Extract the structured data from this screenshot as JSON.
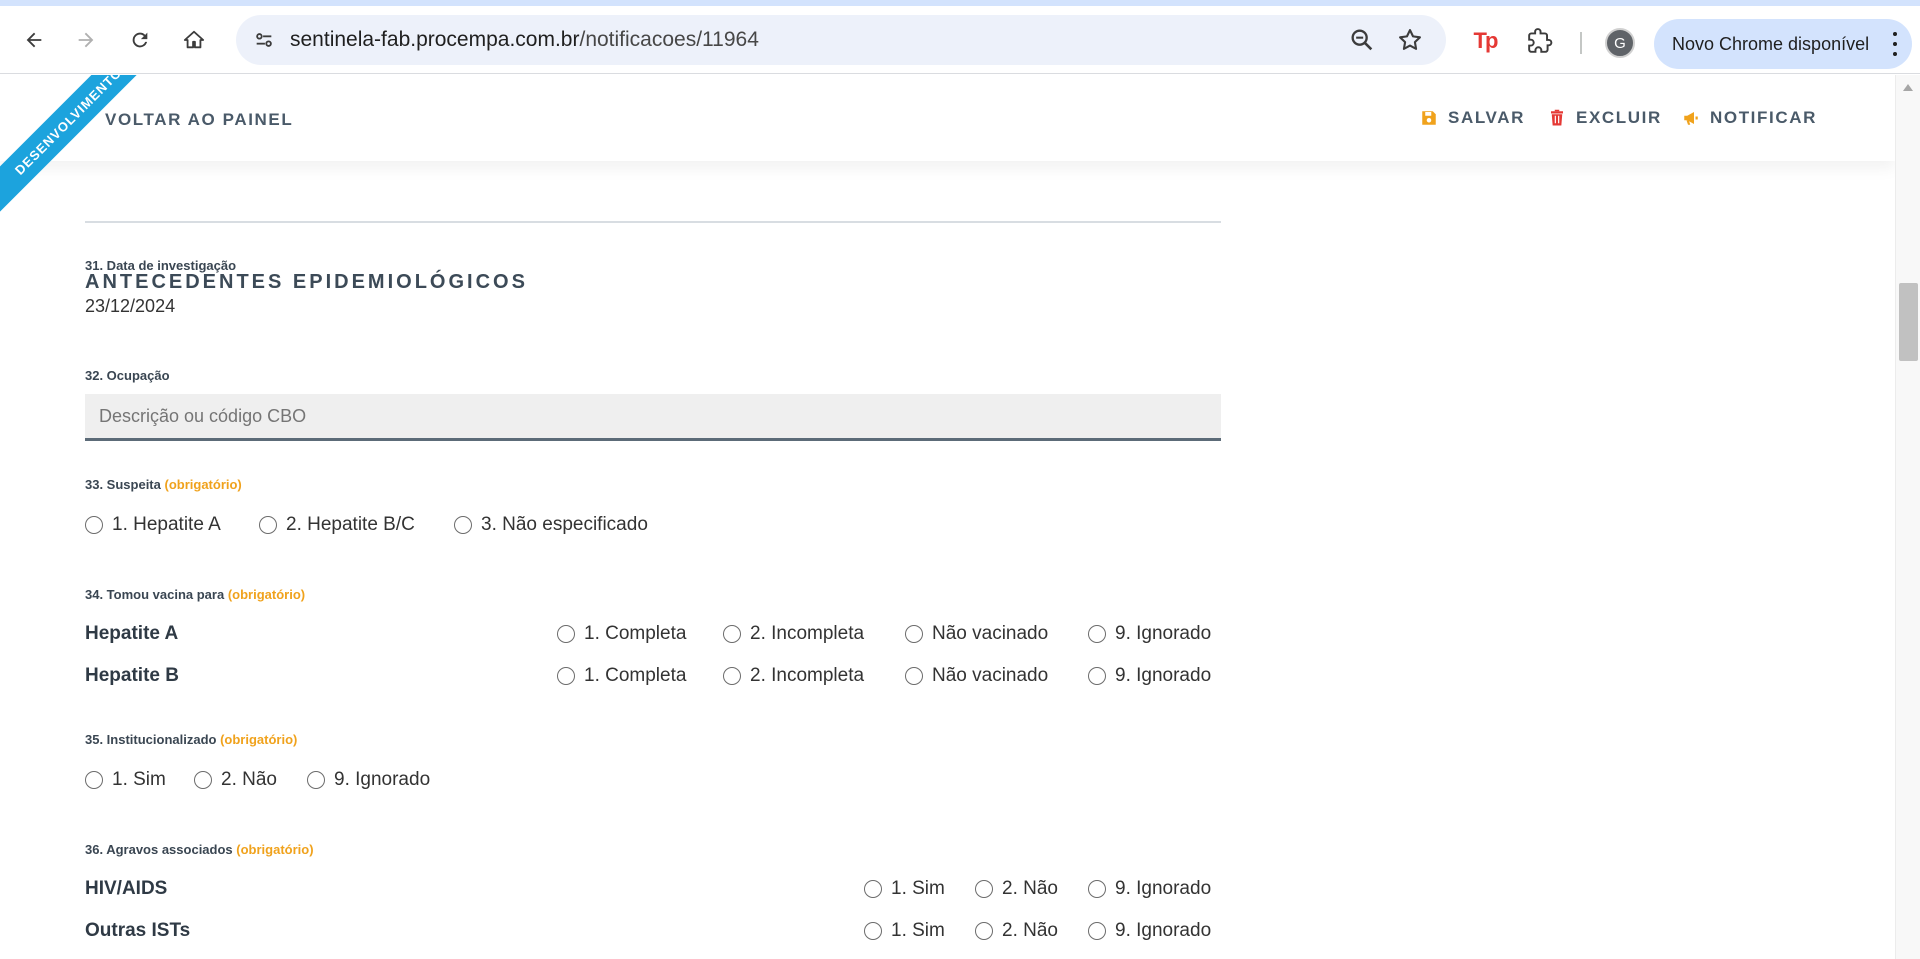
{
  "browser": {
    "url_host": "sentinela-fab.procempa.com.br",
    "url_path": "/notificacoes/11964",
    "avatar_letter": "G",
    "update_label": "Novo Chrome disponível",
    "ext_tp_label": "Tp"
  },
  "ribbon": {
    "label": "DESENVOLVIMENTO",
    "color": "#1ca3dd"
  },
  "actions": {
    "back_label": "VOLTAR AO PAINEL",
    "save_label": "SALVAR",
    "delete_label": "EXCLUIR",
    "notify_label": "NOTIFICAR",
    "save_color": "#f0a21c",
    "delete_color": "#e53935",
    "notify_color": "#f0a21c"
  },
  "section": {
    "title": "ANTECEDENTES EPIDEMIOLÓGICOS"
  },
  "required_marker": "(obrigatório)",
  "q31": {
    "label": "31. Data de investigação",
    "value": "23/12/2024"
  },
  "q32": {
    "label": "32. Ocupação",
    "placeholder": "Descrição ou código CBO"
  },
  "q33": {
    "label": "33. Suspeita",
    "options": [
      "1. Hepatite A",
      "2. Hepatite B/C",
      "3. Não especificado"
    ]
  },
  "q34": {
    "label": "34. Tomou vacina para",
    "rows": [
      {
        "label": "Hepatite A",
        "options": [
          "1. Completa",
          "2. Incompleta",
          "Não vacinado",
          "9. Ignorado"
        ]
      },
      {
        "label": "Hepatite B",
        "options": [
          "1. Completa",
          "2. Incompleta",
          "Não vacinado",
          "9. Ignorado"
        ]
      }
    ]
  },
  "q35": {
    "label": "35. Institucionalizado",
    "options": [
      "1. Sim",
      "2. Não",
      "9. Ignorado"
    ]
  },
  "q36": {
    "label": "36. Agravos associados",
    "rows": [
      {
        "label": "HIV/AIDS",
        "options": [
          "1. Sim",
          "2. Não",
          "9. Ignorado"
        ]
      },
      {
        "label": "Outras ISTs",
        "options": [
          "1. Sim",
          "2. Não",
          "9. Ignorado"
        ]
      }
    ]
  }
}
